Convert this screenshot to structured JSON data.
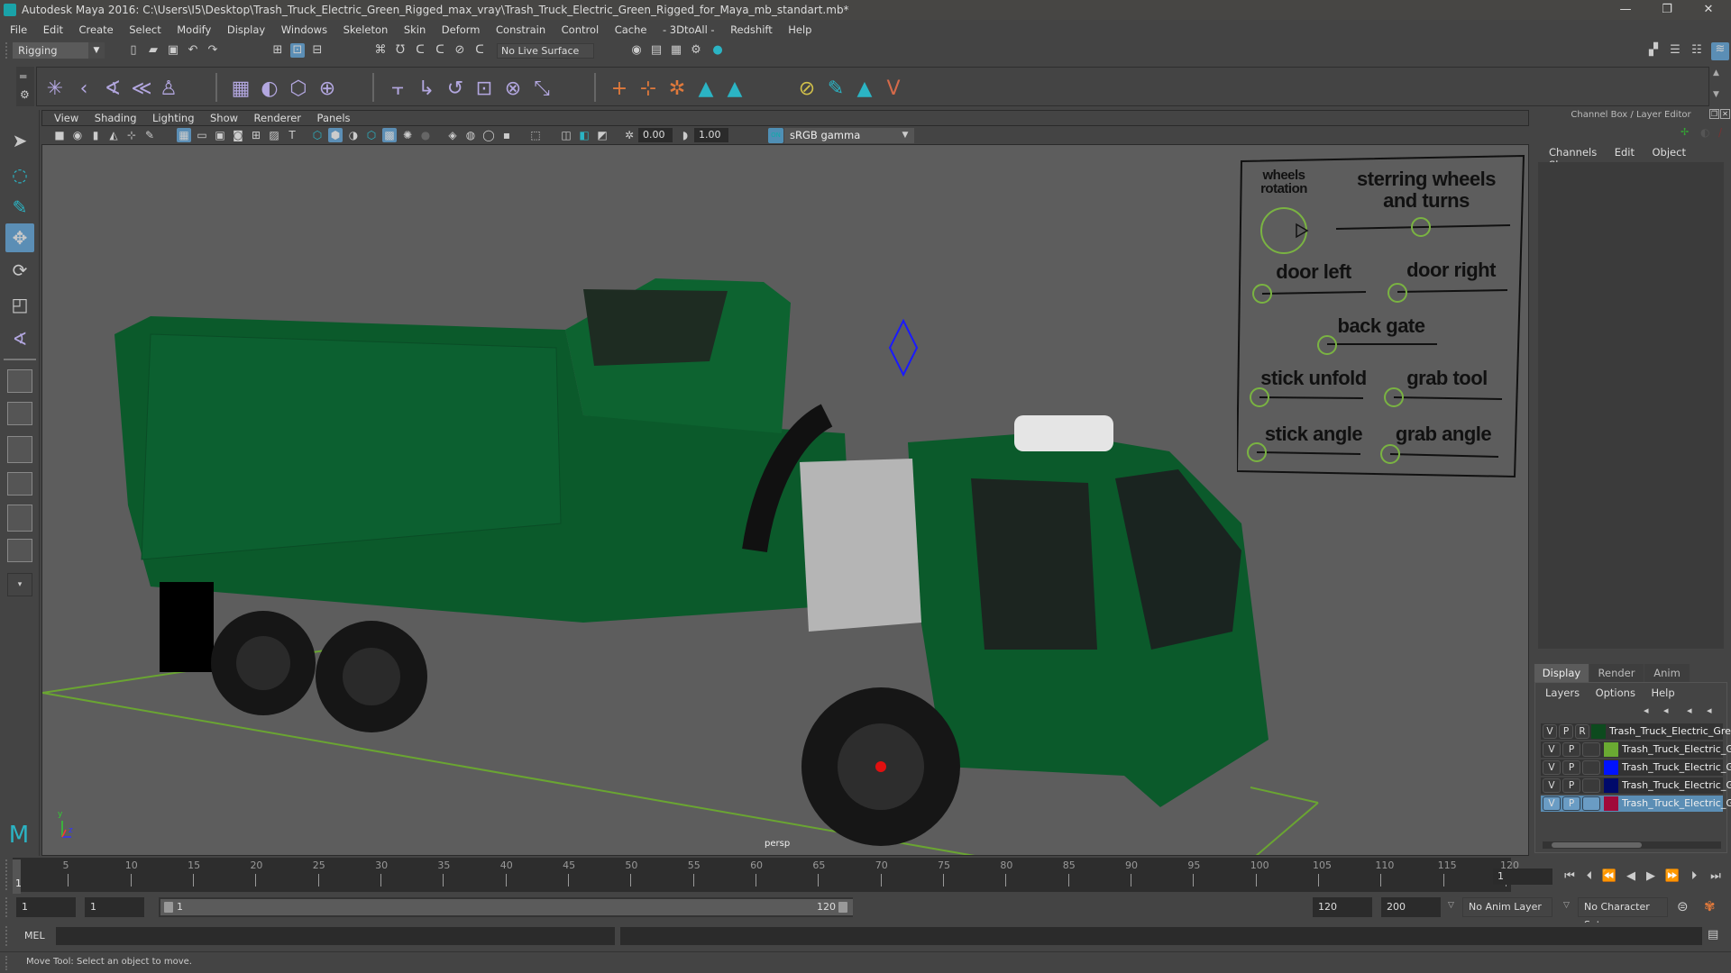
{
  "window": {
    "title": "Autodesk Maya 2016: C:\\Users\\I5\\Desktop\\Trash_Truck_Electric_Green_Rigged_max_vray\\Trash_Truck_Electric_Green_Rigged_for_Maya_mb_standart.mb*",
    "minimize": "—",
    "restore": "❐",
    "close": "✕"
  },
  "menubar": [
    "File",
    "Edit",
    "Create",
    "Select",
    "Modify",
    "Display",
    "Windows",
    "Skeleton",
    "Skin",
    "Deform",
    "Constrain",
    "Control",
    "Cache",
    "- 3DtoAll -",
    "Redshift",
    "Help"
  ],
  "statusline": {
    "mode": "Rigging",
    "live_surface": "No Live Surface"
  },
  "viewport": {
    "menu": [
      "View",
      "Shading",
      "Lighting",
      "Show",
      "Renderer",
      "Panels"
    ],
    "exposure": "0.00",
    "gamma": "1.00",
    "color_mgmt_toggle": "ON",
    "color_space": "sRGB gamma",
    "camera_label": "persp",
    "axis": {
      "y": "y",
      "z": "z"
    }
  },
  "rig_controls": {
    "wheels_rotation": "wheels\nrotation",
    "steering": "sterring wheels\nand turns",
    "door_left": "door left",
    "door_right": "door right",
    "back_gate": "back gate",
    "stick_unfold": "stick unfold",
    "grab_tool": "grab tool",
    "stick_angle": "stick angle",
    "grab_angle": "grab angle"
  },
  "channel_box": {
    "title": "Channel Box / Layer Editor",
    "menu": [
      "Channels",
      "Edit",
      "Object",
      "Show"
    ]
  },
  "layer_editor": {
    "tabs": [
      "Display",
      "Render",
      "Anim"
    ],
    "active_tab": "Display",
    "menu": [
      "Layers",
      "Options",
      "Help"
    ],
    "layers": [
      {
        "v": "V",
        "p": "P",
        "r": "R",
        "color": "#0d4a1e",
        "name": "Trash_Truck_Electric_Green",
        "selected": false
      },
      {
        "v": "V",
        "p": "P",
        "r": "",
        "color": "#6aaa32",
        "name": "Trash_Truck_Electric_G",
        "selected": false
      },
      {
        "v": "V",
        "p": "P",
        "r": "",
        "color": "#0012ff",
        "name": "Trash_Truck_Electric_G",
        "selected": false
      },
      {
        "v": "V",
        "p": "P",
        "r": "",
        "color": "#000a6a",
        "name": "Trash_Truck_Electric_G",
        "selected": false
      },
      {
        "v": "V",
        "p": "P",
        "r": "",
        "color": "#a0093a",
        "name": "Trash_Truck_Electric_G",
        "selected": true
      }
    ]
  },
  "timeline": {
    "ticks": [
      5,
      10,
      15,
      20,
      25,
      30,
      35,
      40,
      45,
      50,
      55,
      60,
      65,
      70,
      75,
      80,
      85,
      90,
      95,
      100,
      105,
      110,
      115,
      120
    ],
    "start": 1,
    "end": 120,
    "current_frame": "1",
    "current_frame_field": "1"
  },
  "range": {
    "start_field": "1",
    "playback_start": "1",
    "slider_start_label": "1",
    "slider_end_label": "120",
    "playback_end": "120",
    "end_field": "200",
    "anim_layer": "No Anim Layer",
    "character_set": "No Character Set"
  },
  "command_line": {
    "label": "MEL"
  },
  "help_line": "Move Tool: Select an object to move."
}
